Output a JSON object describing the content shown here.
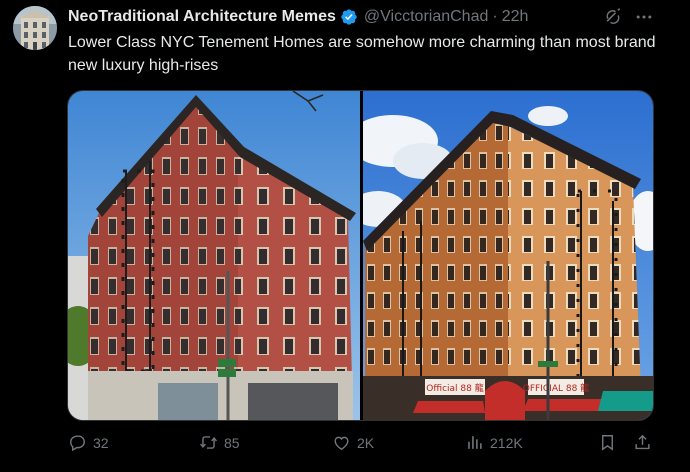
{
  "author": {
    "display_name": "NeoTraditional Architecture Memes",
    "handle": "@VicctorianChad",
    "separator": "·",
    "time": "22h",
    "verified": true
  },
  "tweet": {
    "text": "Lower Class NYC Tenement Homes are somehow more charming than most brand new luxury high-rises"
  },
  "media": {
    "left_signs": [],
    "right_signs": [
      "Official 88 龍",
      "OFFICIAL 88 龍"
    ]
  },
  "actions": {
    "replies": "32",
    "retweets": "85",
    "likes": "2K",
    "views": "212K"
  },
  "colors": {
    "background": "#000000",
    "text": "#e7e9ea",
    "muted": "#71767b",
    "verified": "#1d9bf0"
  }
}
